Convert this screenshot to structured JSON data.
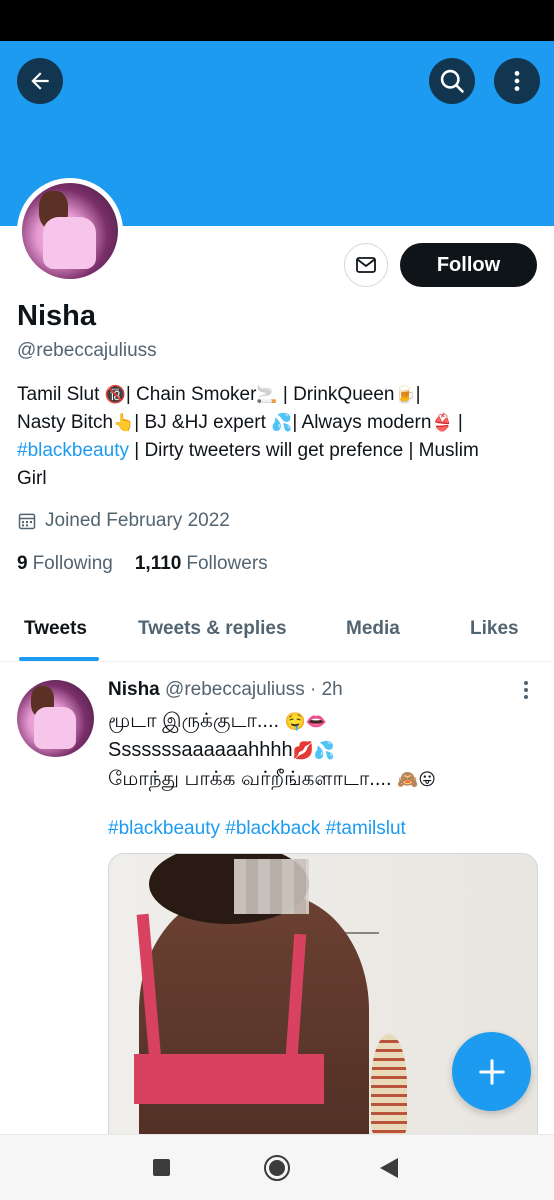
{
  "profile": {
    "name": "Nisha",
    "handle": "@rebeccajuliuss",
    "bio": {
      "line1": [
        "Tamil Slut ",
        "🔞",
        "| Chain Smoker",
        "🚬",
        " | DrinkQueen",
        "🍺",
        "|"
      ],
      "line2": [
        "Nasty Bitch",
        "👆",
        "| BJ &HJ expert ",
        "💦",
        "| Always modern",
        "👙",
        " |"
      ],
      "hashtag": "#blackbeauty",
      "line3_rest": " | Dirty tweeters will get prefence | Muslim",
      "line4": "Girl"
    },
    "joined": "Joined February 2022",
    "following_count": "9",
    "following_label": "Following",
    "followers_count": "1,110",
    "followers_label": "Followers"
  },
  "actions": {
    "follow_label": "Follow"
  },
  "tabs": [
    {
      "label": "Tweets",
      "active": true
    },
    {
      "label": "Tweets & replies",
      "active": false
    },
    {
      "label": "Media",
      "active": false
    },
    {
      "label": "Likes",
      "active": false
    }
  ],
  "tweet": {
    "name": "Nisha",
    "handle": "@rebeccajuliuss",
    "separator": "·",
    "time": "2h",
    "line1": [
      "மூடா இருக்குடா.... ",
      "🤤👄"
    ],
    "line2": [
      "Sssssssaaaaaahhhh",
      "💋💦"
    ],
    "line3": [
      "மோந்து பாக்க வர்றீங்களாடா.... ",
      "🙈😛"
    ],
    "hashtags": "#blackbeauty #blackback #tamilslut"
  },
  "colors": {
    "accent": "#1d9bf0",
    "text": "#0f1419",
    "secondary": "#536471"
  },
  "icons": {
    "back": "arrow-left-icon",
    "search": "search-icon",
    "more": "more-vertical-icon",
    "message": "envelope-icon",
    "calendar": "calendar-icon",
    "compose": "plus-icon"
  }
}
